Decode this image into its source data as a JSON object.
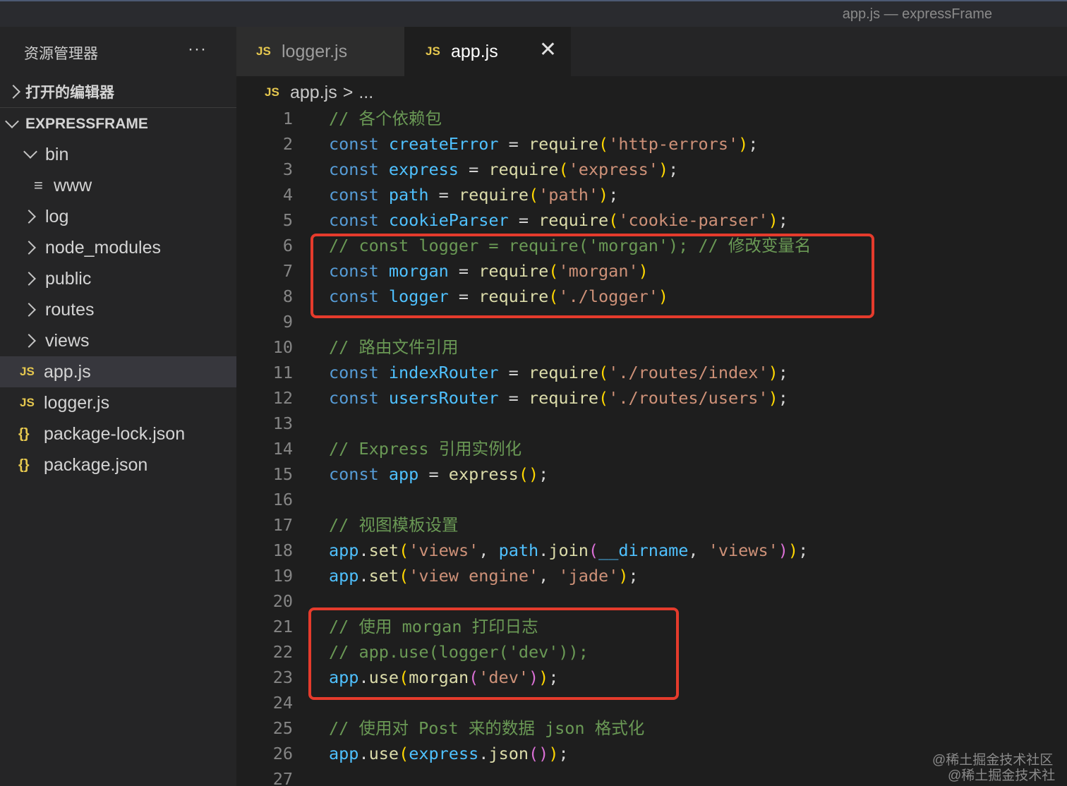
{
  "window": {
    "title": "app.js — expressFrame"
  },
  "sidebar": {
    "heading": "资源管理器",
    "more": "···",
    "open_editors": "打开的编辑器",
    "project": "EXPRESSFRAME",
    "tree": [
      {
        "label": "bin",
        "kind": "folder-open"
      },
      {
        "label": "www",
        "kind": "file-text"
      },
      {
        "label": "log",
        "kind": "folder"
      },
      {
        "label": "node_modules",
        "kind": "folder"
      },
      {
        "label": "public",
        "kind": "folder"
      },
      {
        "label": "routes",
        "kind": "folder"
      },
      {
        "label": "views",
        "kind": "folder"
      },
      {
        "label": "app.js",
        "kind": "js",
        "selected": true
      },
      {
        "label": "logger.js",
        "kind": "js"
      },
      {
        "label": "package-lock.json",
        "kind": "json"
      },
      {
        "label": "package.json",
        "kind": "json"
      }
    ],
    "icons": {
      "js": "JS",
      "json": "{}",
      "text": "≡"
    }
  },
  "tabs": [
    {
      "label": "logger.js",
      "icon": "JS",
      "active": false
    },
    {
      "label": "app.js",
      "icon": "JS",
      "active": true,
      "close": "✕"
    }
  ],
  "breadcrumb": {
    "icon": "JS",
    "file": "app.js",
    "sep": ">",
    "rest": "..."
  },
  "code": [
    {
      "n": "1",
      "t": [
        [
          "c",
          "// 各个依赖包"
        ]
      ]
    },
    {
      "n": "2",
      "t": [
        [
          "k",
          "const "
        ],
        [
          "v",
          "createError"
        ],
        [
          "p",
          " = "
        ],
        [
          "f",
          "require"
        ],
        [
          "b1",
          "("
        ],
        [
          "s",
          "'http-errors'"
        ],
        [
          "b1",
          ")"
        ],
        [
          "p",
          ";"
        ]
      ]
    },
    {
      "n": "3",
      "t": [
        [
          "k",
          "const "
        ],
        [
          "v",
          "express"
        ],
        [
          "p",
          " = "
        ],
        [
          "f",
          "require"
        ],
        [
          "b1",
          "("
        ],
        [
          "s",
          "'express'"
        ],
        [
          "b1",
          ")"
        ],
        [
          "p",
          ";"
        ]
      ]
    },
    {
      "n": "4",
      "t": [
        [
          "k",
          "const "
        ],
        [
          "v",
          "path"
        ],
        [
          "p",
          " = "
        ],
        [
          "f",
          "require"
        ],
        [
          "b1",
          "("
        ],
        [
          "s",
          "'path'"
        ],
        [
          "b1",
          ")"
        ],
        [
          "p",
          ";"
        ]
      ]
    },
    {
      "n": "5",
      "t": [
        [
          "k",
          "const "
        ],
        [
          "v",
          "cookieParser"
        ],
        [
          "p",
          " = "
        ],
        [
          "f",
          "require"
        ],
        [
          "b1",
          "("
        ],
        [
          "s",
          "'cookie-parser'"
        ],
        [
          "b1",
          ")"
        ],
        [
          "p",
          ";"
        ]
      ]
    },
    {
      "n": "6",
      "t": [
        [
          "c",
          "// const logger = require('morgan'); // 修改变量名"
        ]
      ]
    },
    {
      "n": "7",
      "t": [
        [
          "k",
          "const "
        ],
        [
          "v",
          "morgan"
        ],
        [
          "p",
          " = "
        ],
        [
          "f",
          "require"
        ],
        [
          "b1",
          "("
        ],
        [
          "s",
          "'morgan'"
        ],
        [
          "b1",
          ")"
        ]
      ]
    },
    {
      "n": "8",
      "t": [
        [
          "k",
          "const "
        ],
        [
          "v",
          "logger"
        ],
        [
          "p",
          " = "
        ],
        [
          "f",
          "require"
        ],
        [
          "b1",
          "("
        ],
        [
          "s",
          "'./logger'"
        ],
        [
          "b1",
          ")"
        ]
      ]
    },
    {
      "n": "9",
      "t": []
    },
    {
      "n": "10",
      "t": [
        [
          "c",
          "// 路由文件引用"
        ]
      ]
    },
    {
      "n": "11",
      "t": [
        [
          "k",
          "const "
        ],
        [
          "v",
          "indexRouter"
        ],
        [
          "p",
          " = "
        ],
        [
          "f",
          "require"
        ],
        [
          "b1",
          "("
        ],
        [
          "s",
          "'./routes/index'"
        ],
        [
          "b1",
          ")"
        ],
        [
          "p",
          ";"
        ]
      ]
    },
    {
      "n": "12",
      "t": [
        [
          "k",
          "const "
        ],
        [
          "v",
          "usersRouter"
        ],
        [
          "p",
          " = "
        ],
        [
          "f",
          "require"
        ],
        [
          "b1",
          "("
        ],
        [
          "s",
          "'./routes/users'"
        ],
        [
          "b1",
          ")"
        ],
        [
          "p",
          ";"
        ]
      ]
    },
    {
      "n": "13",
      "t": []
    },
    {
      "n": "14",
      "t": [
        [
          "c",
          "// Express 引用实例化"
        ]
      ]
    },
    {
      "n": "15",
      "t": [
        [
          "k",
          "const "
        ],
        [
          "v",
          "app"
        ],
        [
          "p",
          " = "
        ],
        [
          "f",
          "express"
        ],
        [
          "b1",
          "()"
        ],
        [
          "p",
          ";"
        ]
      ]
    },
    {
      "n": "16",
      "t": []
    },
    {
      "n": "17",
      "t": [
        [
          "c",
          "// 视图模板设置"
        ]
      ]
    },
    {
      "n": "18",
      "t": [
        [
          "v",
          "app"
        ],
        [
          "p",
          "."
        ],
        [
          "f",
          "set"
        ],
        [
          "b1",
          "("
        ],
        [
          "s",
          "'views'"
        ],
        [
          "p",
          ", "
        ],
        [
          "v",
          "path"
        ],
        [
          "p",
          "."
        ],
        [
          "f",
          "join"
        ],
        [
          "b2",
          "("
        ],
        [
          "v",
          "__dirname"
        ],
        [
          "p",
          ", "
        ],
        [
          "s",
          "'views'"
        ],
        [
          "b2",
          ")"
        ],
        [
          "b1",
          ")"
        ],
        [
          "p",
          ";"
        ]
      ]
    },
    {
      "n": "19",
      "t": [
        [
          "v",
          "app"
        ],
        [
          "p",
          "."
        ],
        [
          "f",
          "set"
        ],
        [
          "b1",
          "("
        ],
        [
          "s",
          "'view engine'"
        ],
        [
          "p",
          ", "
        ],
        [
          "s",
          "'jade'"
        ],
        [
          "b1",
          ")"
        ],
        [
          "p",
          ";"
        ]
      ]
    },
    {
      "n": "20",
      "t": []
    },
    {
      "n": "21",
      "t": [
        [
          "c",
          "// 使用 morgan 打印日志"
        ]
      ]
    },
    {
      "n": "22",
      "t": [
        [
          "c",
          "// app.use(logger('dev'));"
        ]
      ]
    },
    {
      "n": "23",
      "t": [
        [
          "v",
          "app"
        ],
        [
          "p",
          "."
        ],
        [
          "f",
          "use"
        ],
        [
          "b1",
          "("
        ],
        [
          "f",
          "morgan"
        ],
        [
          "b2",
          "("
        ],
        [
          "s",
          "'dev'"
        ],
        [
          "b2",
          ")"
        ],
        [
          "b1",
          ")"
        ],
        [
          "p",
          ";"
        ]
      ]
    },
    {
      "n": "24",
      "t": []
    },
    {
      "n": "25",
      "t": [
        [
          "c",
          "// 使用对 Post 来的数据 json 格式化"
        ]
      ]
    },
    {
      "n": "26",
      "t": [
        [
          "v",
          "app"
        ],
        [
          "p",
          "."
        ],
        [
          "f",
          "use"
        ],
        [
          "b1",
          "("
        ],
        [
          "v",
          "express"
        ],
        [
          "p",
          "."
        ],
        [
          "f",
          "json"
        ],
        [
          "b2",
          "()"
        ],
        [
          "b1",
          ")"
        ],
        [
          "p",
          ";"
        ]
      ]
    },
    {
      "n": "27",
      "t": []
    }
  ],
  "watermark": [
    "@稀土掘金技术社区",
    "@稀土掘金技术社区"
  ],
  "colors": {
    "highlight_box": "#e53b2c",
    "js_icon": "#e6c84f"
  }
}
